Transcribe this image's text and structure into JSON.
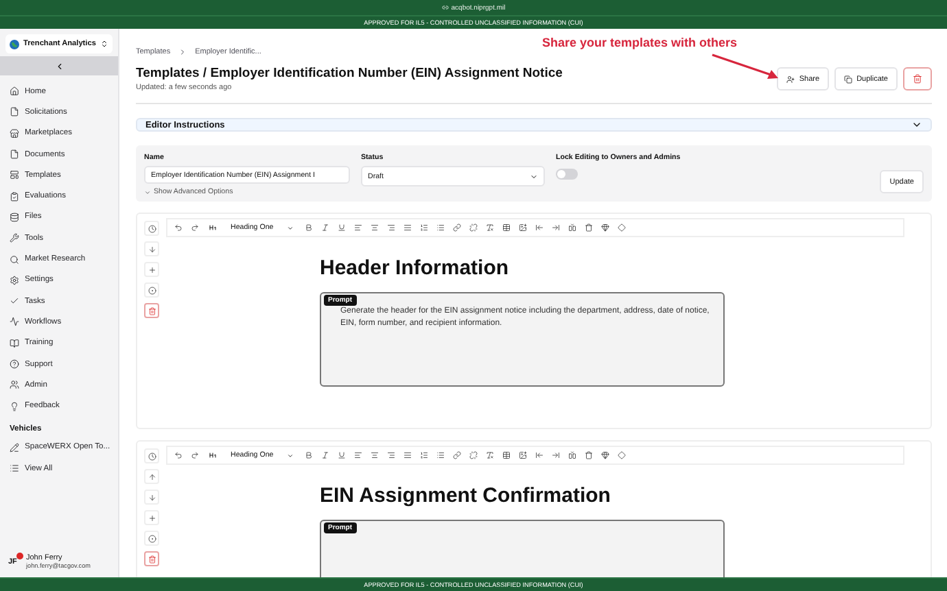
{
  "browser": {
    "url": "acqbot.niprgpt.mil"
  },
  "banner_top": "APPROVED FOR IL5 - CONTROLLED UNCLASSIFIED INFORMATION (CUI)",
  "sidebar": {
    "org": "Trenchant Analytics",
    "items": [
      {
        "label": "Home"
      },
      {
        "label": "Solicitations"
      },
      {
        "label": "Marketplaces"
      },
      {
        "label": "Documents"
      },
      {
        "label": "Templates"
      },
      {
        "label": "Evaluations"
      },
      {
        "label": "Files"
      },
      {
        "label": "Tools"
      },
      {
        "label": "Market Research"
      },
      {
        "label": "Settings"
      },
      {
        "label": "Tasks"
      },
      {
        "label": "Workflows"
      },
      {
        "label": "Training"
      },
      {
        "label": "Support"
      },
      {
        "label": "Admin"
      },
      {
        "label": "Feedback"
      }
    ],
    "section": "Vehicles",
    "vehicles": [
      {
        "label": "SpaceWERX Open To..."
      },
      {
        "label": "View All"
      }
    ],
    "user": {
      "initials": "JF",
      "name": "John Ferry",
      "email": "john.ferry@tacgov.com"
    }
  },
  "breadcrumb": [
    "Templates",
    "Employer Identific..."
  ],
  "annotation": "Share your templates with others",
  "title": "Templates / Employer Identification Number (EIN) Assignment Notice",
  "updated": "Updated: a few seconds ago",
  "actions": [
    {
      "label": "Share",
      "kind": "share"
    },
    {
      "label": "Duplicate",
      "kind": "duplicate"
    },
    {
      "kind": "delete"
    }
  ],
  "instructions": {
    "title": "Editor Instructions",
    "expanded": false
  },
  "form": {
    "name_label": "Name",
    "name_value": "Employer Identification Number (EIN) Assignment I",
    "status_label": "Status",
    "status_value": "Draft",
    "lock_label": "Lock Editing to Owners and Admins",
    "lock_on": false,
    "advanced": "Show Advanced Options",
    "update": "Update"
  },
  "blocks": [
    {
      "style": "Heading One",
      "can_move_up": false,
      "heading": "Header Information",
      "prompt_tag": "Prompt",
      "prompt": "Generate the header for the EIN assignment notice including the department, address, date of notice, EIN, form number, and recipient information."
    },
    {
      "style": "Heading One",
      "can_move_up": true,
      "heading": "EIN Assignment Confirmation",
      "prompt_tag": "Prompt"
    }
  ],
  "banner_bottom": "APPROVED FOR IL5 - CONTROLLED UNCLASSIFIED INFORMATION (CUI)"
}
